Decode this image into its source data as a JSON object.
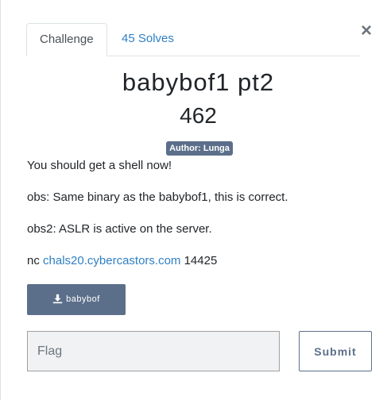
{
  "modal": {
    "close_glyph": "×",
    "tabs": [
      {
        "label": "Challenge",
        "active": true
      },
      {
        "label": "45 Solves",
        "active": false
      }
    ],
    "challenge": {
      "name": "babybof1 pt2",
      "points": "462",
      "author_badge": "Author: Lunga",
      "description": [
        "You should get a shell now!",
        "obs: Same binary as the babybof1, this is correct.",
        "obs2: ASLR is active on the server."
      ],
      "connection": {
        "prefix": "nc",
        "host": "chals20.cybercastors.com",
        "port": "14425"
      },
      "file_label": "babybof"
    },
    "form": {
      "flag_placeholder": "Flag",
      "flag_value": "",
      "submit_label": "Submit"
    }
  },
  "colors": {
    "link": "#2f80c4",
    "badge": "#5c6f8a",
    "input_bg": "#f1f2f4"
  }
}
